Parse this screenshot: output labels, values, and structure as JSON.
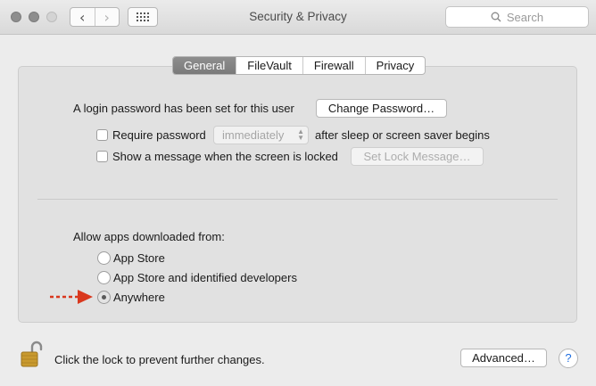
{
  "window": {
    "title": "Security & Privacy",
    "back_glyph": "‹",
    "forward_glyph": "›",
    "search_placeholder": "Search"
  },
  "tabs": [
    {
      "label": "General",
      "active": true
    },
    {
      "label": "FileVault",
      "active": false
    },
    {
      "label": "Firewall",
      "active": false
    },
    {
      "label": "Privacy",
      "active": false
    }
  ],
  "general": {
    "login_password_text": "A login password has been set for this user",
    "change_password_label": "Change Password…",
    "require_password_label": "Require password",
    "require_password_checked": false,
    "require_password_value": "immediately",
    "after_sleep_text": "after sleep or screen saver begins",
    "show_message_label": "Show a message when the screen is locked",
    "show_message_checked": false,
    "set_lock_message_label": "Set Lock Message…"
  },
  "allow_apps": {
    "heading": "Allow apps downloaded from:",
    "options": [
      {
        "label": "App Store",
        "selected": false
      },
      {
        "label": "App Store and identified developers",
        "selected": false
      },
      {
        "label": "Anywhere",
        "selected": true
      }
    ]
  },
  "footer": {
    "lock_text": "Click the lock to prevent further changes.",
    "advanced_label": "Advanced…",
    "help_label": "?"
  },
  "colors": {
    "annotation_arrow": "#d9381e",
    "lock_gold": "#c99a2e",
    "help_blue": "#1f6fe0"
  },
  "icons": [
    "back-chevron-icon",
    "forward-chevron-icon",
    "show-all-grid-icon",
    "search-icon",
    "padlock-unlocked-icon",
    "red-arrow-annotation-icon"
  ]
}
